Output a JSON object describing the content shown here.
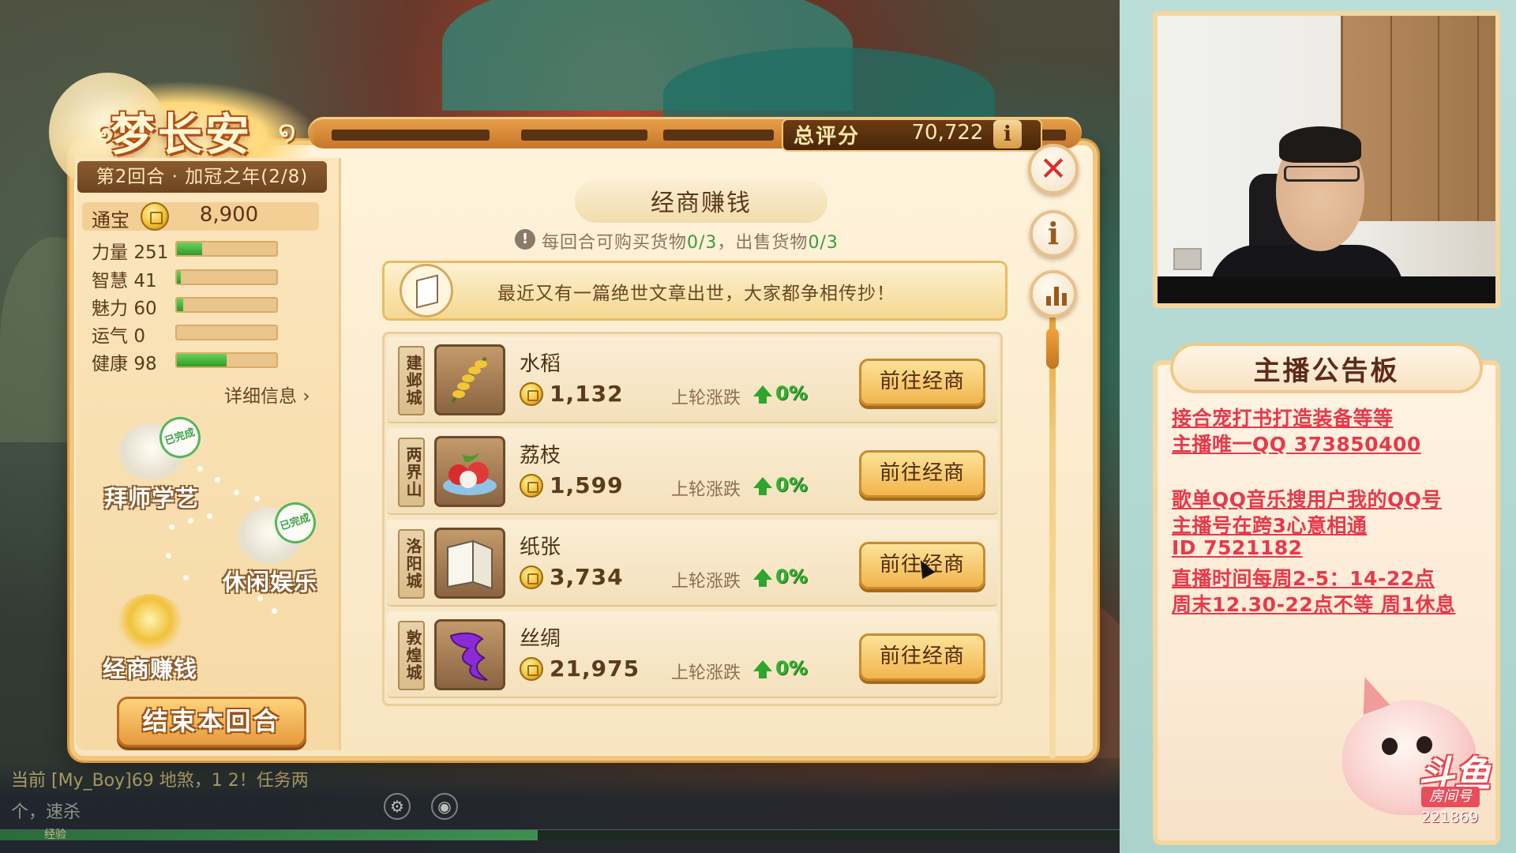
{
  "game": {
    "logo_text": "梦长安",
    "total_score_label": "总评分",
    "total_score_value": "70,722",
    "round_info": "第2回合 · 加冠之年(2/8)",
    "currency_label": "通宝",
    "currency_value": "8,900",
    "stats": [
      {
        "label": "力量",
        "value": "251",
        "level": 0.25
      },
      {
        "label": "智慧",
        "value": "41",
        "level": 0.04
      },
      {
        "label": "魅力",
        "value": "60",
        "level": 0.06
      },
      {
        "label": "运气",
        "value": "0",
        "level": 0
      },
      {
        "label": "健康",
        "value": "98",
        "level": 0.5
      }
    ],
    "details_link": "详细信息",
    "activities": [
      {
        "label": "拜师学艺",
        "badge": "已完成"
      },
      {
        "label": "休闲娱乐",
        "badge": "已完成"
      },
      {
        "label": "经商赚钱"
      }
    ],
    "end_round_button": "结束本回合",
    "section_title": "经商赚钱",
    "notice_prefix": "每回合可购买货物",
    "notice_buy": "0/3",
    "notice_mid": "，出售货物",
    "notice_sell": "0/3",
    "news_text": "最近又有一篇绝世文章出世，大家都争相传抄！",
    "goods": [
      {
        "city": "建邺城",
        "name": "水稻",
        "price": "1,132",
        "trend_label": "上轮涨跌",
        "trend": "0%",
        "button": "前往经商",
        "icon": "rice-icon"
      },
      {
        "city": "两界山",
        "name": "荔枝",
        "price": "1,599",
        "trend_label": "上轮涨跌",
        "trend": "0%",
        "button": "前往经商",
        "icon": "lychee-icon"
      },
      {
        "city": "洛阳城",
        "name": "纸张",
        "price": "3,734",
        "trend_label": "上轮涨跌",
        "trend": "0%",
        "button": "前往经商",
        "icon": "paper-icon"
      },
      {
        "city": "敦煌城",
        "name": "丝绸",
        "price": "21,975",
        "trend_label": "上轮涨跌",
        "trend": "0%",
        "button": "前往经商",
        "icon": "silk-icon"
      }
    ],
    "close_icon": "close-icon",
    "info_icon": "info-icon",
    "stats_icon": "bar-chart-icon",
    "chat_line_1": "当前 [My_Boy]69 地煞，1 2！任务两",
    "chat_line_2": "个，速杀",
    "exp_label": "经验",
    "exp_level": 0.48
  },
  "overlay": {
    "board_title": "主播公告板",
    "board_lines": [
      "接合宠打书打造装备等等",
      "主播唯一QQ 373850400",
      "",
      "歌单QQ音乐搜用户我的QQ号",
      "主播号在跨3心意相通",
      "ID 7521182",
      "直播时间每周2-5：14-22点",
      "周末12.30-22点不等 周1休息"
    ],
    "room_label": "房间号",
    "room_number": "221869",
    "douyu_logo": "斗鱼"
  },
  "colors": {
    "accent_orange": "#e69a3c",
    "board_text_red": "#e7394a",
    "trend_green": "#34b034",
    "close_red": "#d8302a"
  }
}
